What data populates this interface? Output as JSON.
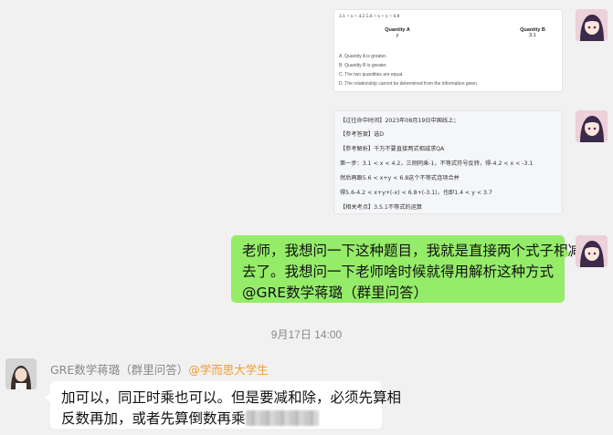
{
  "messages": {
    "q_image": {
      "condition": "3.1 < x < 4.2  5.6 < x + y < 6.8",
      "col_a_title": "Quantity A",
      "col_a_value": "y",
      "col_b_title": "Quantity B",
      "col_b_value": "3.1",
      "options": [
        "A.  Quantity A is greater.",
        "B.  Quantity B is greater.",
        "C.  The two quantities are equal.",
        "D.  The relationship cannot be determined from the information given."
      ]
    },
    "explain_image": {
      "lines": [
        "【过往命中时间】2023年08月19日中国线上；",
        "【参考答案】选D",
        "【参考解析】千万不要直接两式相减求QA",
        "第一步：3.1 < x < 4.2，三侧同乘-1，不等式符号反转，得-4.2 < x < -3.1",
        "然后再跟5.6 < x+y < 6.8这个不等式连项合并",
        "得5.6-4.2 < x+y+(-x) < 6.8+(-3.1)，也即1.4 < y < 3.7",
        "【相关考点】3.5.1不等式的运算"
      ]
    },
    "my_question": {
      "lines": [
        "老师，我想问一下这种题目，我就是直接两个式子相减",
        "去了。我想问一下老师啥时候就得用解析这种方式",
        "@GRE数学蒋璐（群里问答）"
      ]
    },
    "timestamp": "9月17日 14:00",
    "reply": {
      "sender_name": "GRE数学蒋璐（群里问答）",
      "sender_tag": "@学而思大学生",
      "line1": "加可以，同正时乘也可以。但是要减和除，必须先算相",
      "line2": "反数再加，或者先算倒数再乘"
    }
  },
  "colors": {
    "background": "#f1f1f1",
    "my_bubble": "#95ec69",
    "other_bubble": "#ffffff",
    "sender_tag": "#f09a37"
  },
  "icons": [
    "avatar-me",
    "avatar-teacher"
  ]
}
